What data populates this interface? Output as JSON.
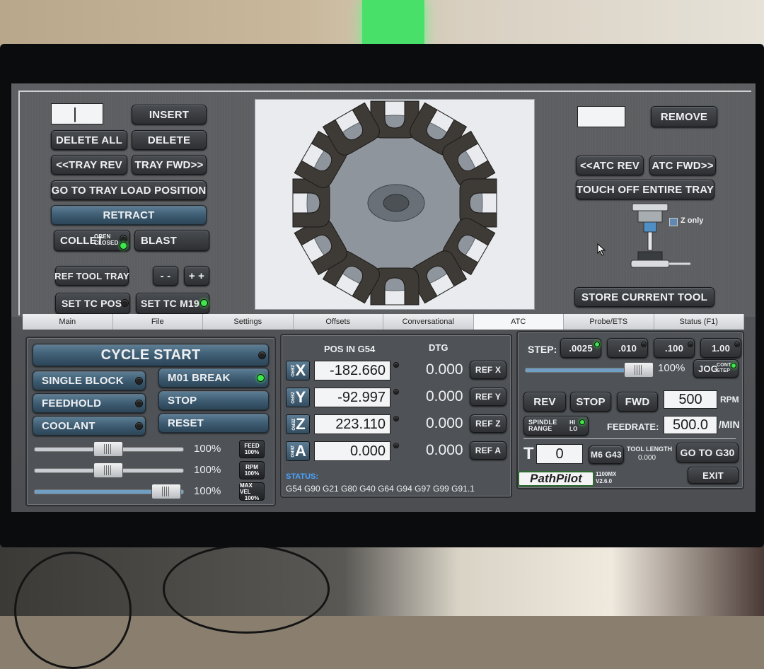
{
  "top_left": {
    "tool_entry_value": "|",
    "insert_label": "INSERT",
    "delete_all_label": "DELETE ALL",
    "delete_label": "DELETE",
    "tray_rev_label": "<<TRAY REV",
    "tray_fwd_label": "TRAY FWD>>",
    "go_to_tray_load_label": "GO TO TRAY LOAD POSITION",
    "retract_label": "RETRACT",
    "collet_label": "COLLET",
    "collet_open": "OPEN",
    "collet_closed": "CLOSED",
    "blast_label": "BLAST",
    "ref_tool_tray_label": "REF TOOL TRAY",
    "minus_label": "- -",
    "plus_label": "+ +",
    "set_tc_pos_label": "SET TC POS",
    "set_tc_m19_label": "SET TC M19"
  },
  "top_right": {
    "remove_entry_value": "",
    "remove_label": "REMOVE",
    "atc_rev_label": "<<ATC REV",
    "atc_fwd_label": "ATC FWD>>",
    "touch_off_label": "TOUCH OFF ENTIRE TRAY",
    "z_only_label": "Z only",
    "store_current_tool_label": "STORE CURRENT TOOL"
  },
  "tabs": [
    "Main",
    "File",
    "Settings",
    "Offsets",
    "Conversational",
    "ATC",
    "Probe/ETS",
    "Status (F1)"
  ],
  "active_tab": "ATC",
  "left_panel": {
    "cycle_start_label": "CYCLE START",
    "single_block_label": "SINGLE BLOCK",
    "m01_break_label": "M01 BREAK",
    "feedhold_label": "FEEDHOLD",
    "stop_label": "STOP",
    "coolant_label": "COOLANT",
    "reset_label": "RESET",
    "overrides": [
      {
        "percent": "100%",
        "badge_top": "FEED",
        "badge_bottom": "100%",
        "level": 1.0
      },
      {
        "percent": "100%",
        "badge_top": "RPM",
        "badge_bottom": "100%",
        "level": 1.0
      },
      {
        "percent": "100%",
        "badge_top": "MAX VEL",
        "badge_bottom": "100%",
        "level": 1.0
      }
    ]
  },
  "dro": {
    "pos_header": "POS IN G54",
    "dtg_header": "DTG",
    "axes": [
      {
        "letter": "X",
        "pos": "-182.660",
        "dtg": "0.000",
        "ref_label": "REF X"
      },
      {
        "letter": "Y",
        "pos": "-92.997",
        "dtg": "0.000",
        "ref_label": "REF Y"
      },
      {
        "letter": "Z",
        "pos": "223.110",
        "dtg": "0.000",
        "ref_label": "REF Z"
      },
      {
        "letter": "A",
        "pos": "0.000",
        "dtg": "0.000",
        "ref_label": "REF A"
      }
    ],
    "status_label": "STATUS:",
    "status_codes": "G54 G90 G21 G80 G40 G64 G94 G97 G99 G91.1"
  },
  "right_panel": {
    "step_label": "STEP:",
    "steps": [
      ".0025",
      ".010",
      ".100",
      "1.00"
    ],
    "jog_percent": "100%",
    "jog_label": "JOG",
    "jog_cont": "CONT",
    "jog_step": "STEP",
    "rev_label": "REV",
    "stop_label": "STOP",
    "fwd_label": "FWD",
    "rpm_value": "500",
    "rpm_unit": "RPM",
    "spindle_range_label_1": "SPINDLE",
    "spindle_range_label_2": "RANGE",
    "range_hi": "HI",
    "range_lo": "LO",
    "feedrate_label": "FEEDRATE:",
    "feedrate_value": "500.0",
    "feedrate_unit": "/MIN",
    "tool_letter": "T",
    "tool_value": "0",
    "m6g43_label": "M6 G43",
    "tool_length_label": "TOOL LENGTH",
    "tool_length_value": "0.000",
    "go_to_g30_label": "GO TO G30",
    "pathpilot_label": "PathPilot",
    "machine_model": "1100MX",
    "version": "V2.6.0",
    "exit_label": "EXIT"
  },
  "colors": {
    "led_on": "#3de84a",
    "accent_blue": "#3c5a70",
    "screen_bg": "#57595c"
  }
}
